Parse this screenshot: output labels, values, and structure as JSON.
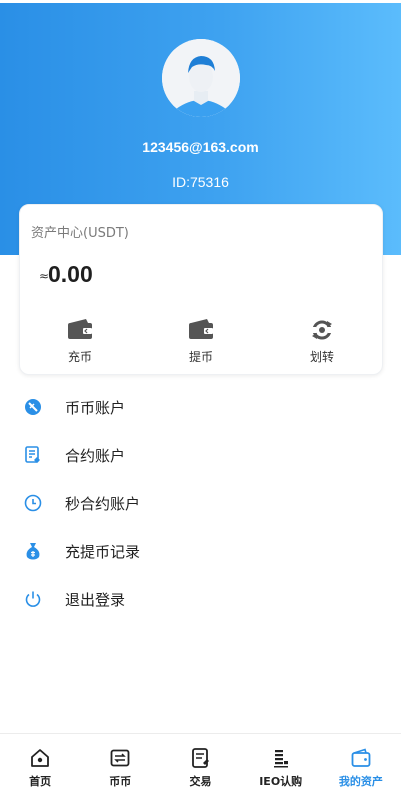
{
  "profile": {
    "email": "123456@163.com",
    "id_text": "ID:75316"
  },
  "assets": {
    "title": "资产中心(USDT)",
    "approx_symbol": "≈",
    "amount": "0.00",
    "actions": [
      {
        "label": "充币",
        "icon": "wallet-icon"
      },
      {
        "label": "提币",
        "icon": "wallet-icon"
      },
      {
        "label": "划转",
        "icon": "transfer-icon"
      }
    ]
  },
  "menu": [
    {
      "label": "币币账户",
      "icon": "coin-account-icon"
    },
    {
      "label": "合约账户",
      "icon": "contract-icon"
    },
    {
      "label": "秒合约账户",
      "icon": "clock-icon"
    },
    {
      "label": "充提币记录",
      "icon": "money-bag-icon"
    },
    {
      "label": "退出登录",
      "icon": "power-icon"
    }
  ],
  "tabs": [
    {
      "label": "首页",
      "icon": "home-icon",
      "active": false
    },
    {
      "label": "币币",
      "icon": "exchange-icon",
      "active": false
    },
    {
      "label": "交易",
      "icon": "trade-icon",
      "active": false
    },
    {
      "label": "IEO认购",
      "icon": "ieo-icon",
      "active": false
    },
    {
      "label": "我的资产",
      "icon": "wallet-icon",
      "active": true
    }
  ],
  "colors": {
    "accent": "#2a8fe6",
    "header_gradient_start": "#2a8fe6",
    "header_gradient_end": "#5bbcfc",
    "icon_dark": "#555555"
  }
}
